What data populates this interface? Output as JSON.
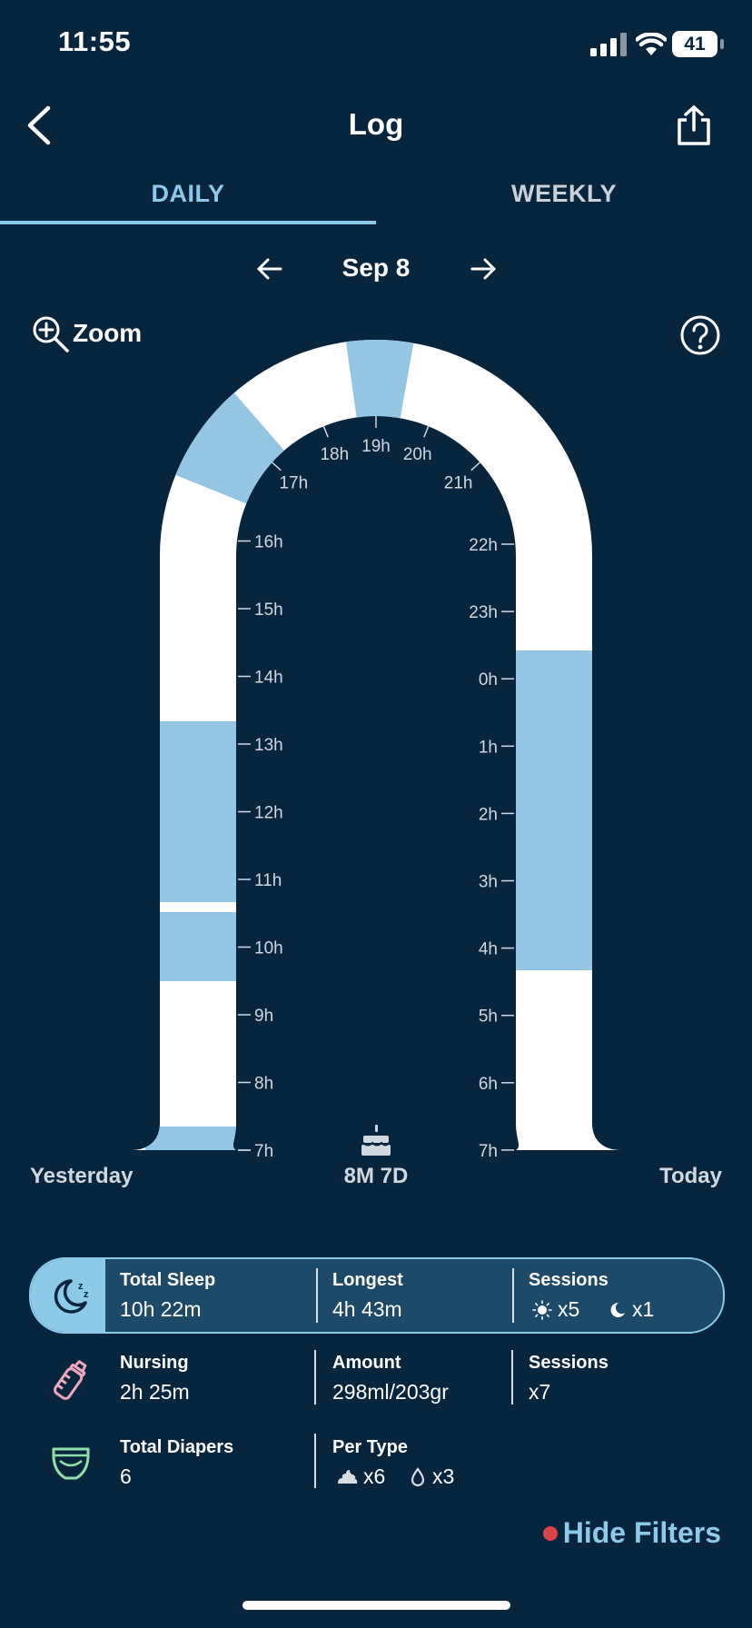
{
  "status_bar": {
    "time": "11:55",
    "battery": "41"
  },
  "nav": {
    "title": "Log"
  },
  "tabs": [
    {
      "label": "DAILY",
      "active": true
    },
    {
      "label": "WEEKLY",
      "active": false
    }
  ],
  "date_nav": {
    "date": "Sep 8"
  },
  "zoom": {
    "label": "Zoom"
  },
  "timeline": {
    "left_hours": [
      "7h",
      "8h",
      "9h",
      "10h",
      "11h",
      "12h",
      "13h",
      "14h",
      "15h",
      "16h"
    ],
    "arch_hours": [
      "17h",
      "18h",
      "19h",
      "20h",
      "21h"
    ],
    "right_hours": [
      "22h",
      "23h",
      "0h",
      "1h",
      "2h",
      "3h",
      "4h",
      "5h",
      "6h",
      "7h"
    ],
    "sleep_color": "#94c6e4",
    "track_color": "#ffffff",
    "left_caption": "Yesterday",
    "right_caption": "Today",
    "age": "8M 7D"
  },
  "sleep_summary": {
    "total_label": "Total Sleep",
    "total_value": "10h 22m",
    "longest_label": "Longest",
    "longest_value": "4h 43m",
    "sessions_label": "Sessions",
    "day_sessions": "x5",
    "night_sessions": "x1"
  },
  "nursing": {
    "label": "Nursing",
    "value": "2h 25m",
    "amount_label": "Amount",
    "amount_value": "298ml/203gr",
    "sessions_label": "Sessions",
    "sessions_value": "x7",
    "icon_color": "#f0a6c0"
  },
  "diapers": {
    "label": "Total Diapers",
    "value": "6",
    "per_type_label": "Per Type",
    "poop_count": "x6",
    "wet_count": "x3",
    "icon_color": "#8fe0a8"
  },
  "filters": {
    "label": "Hide Filters",
    "dot_color": "#d9434a"
  }
}
